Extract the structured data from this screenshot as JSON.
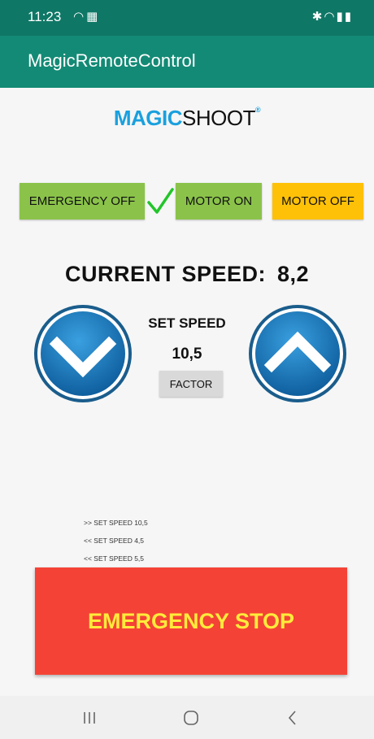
{
  "status_bar": {
    "time": "11:23",
    "left_icons": "wifi-icon tcl-icon",
    "right_icons": "bluetooth-icon wifi-icon signal-icon battery-icon"
  },
  "app_bar": {
    "title": "MagicRemoteControl"
  },
  "logo": {
    "part1": "MAGIC",
    "part2": "SHOOT",
    "mark": "®"
  },
  "controls": {
    "emergency_off_label": "EMERGENCY OFF",
    "motor_on_label": "MOTOR ON",
    "motor_off_label": "MOTOR OFF"
  },
  "speed": {
    "current_label": "CURRENT SPEED:",
    "current_value": "8,2",
    "set_label": "SET SPEED",
    "set_value": "10,5",
    "factor_label": "FACTOR"
  },
  "log": [
    ">> SET SPEED 10,5",
    "<< SET SPEED 4,5",
    "<< SET SPEED 5,5"
  ],
  "emergency_stop_label": "EMERGENCY STOP",
  "colors": {
    "status_bar": "#0f7766",
    "app_bar": "#138a75",
    "green_button": "#8bc34a",
    "yellow_button": "#ffc107",
    "stop_button": "#f44336",
    "stop_text": "#ffeb3b",
    "circle_blue": "#1876b8"
  }
}
